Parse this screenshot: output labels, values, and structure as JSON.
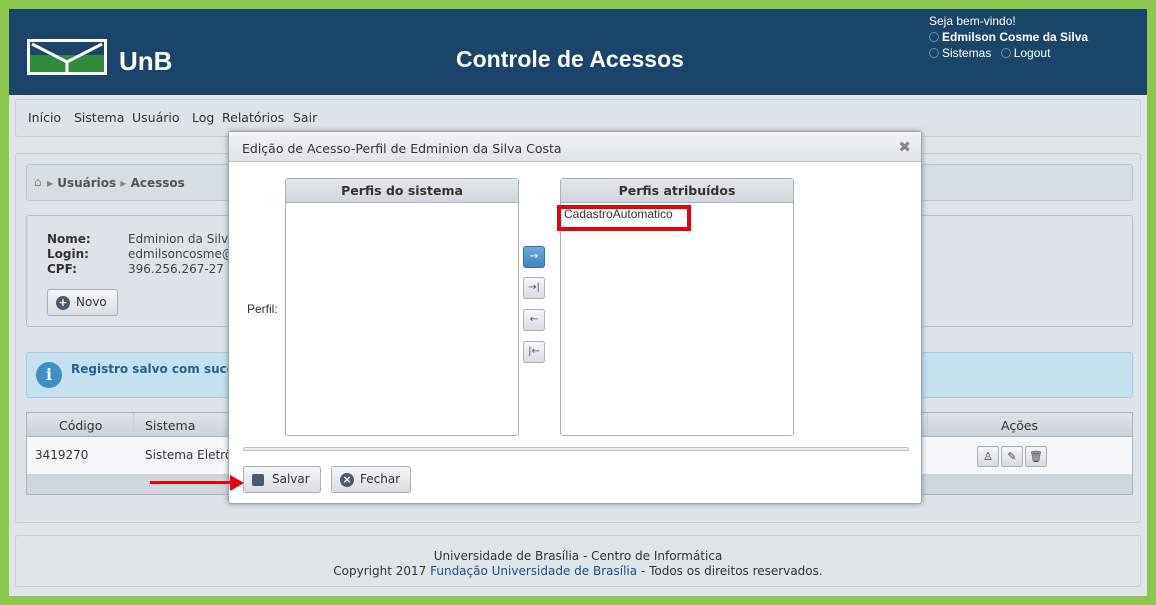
{
  "header": {
    "brand": "UnB",
    "title": "Controle de Acessos",
    "welcome": "Seja bem-vindo!",
    "user": "Edmilson Cosme da Silva",
    "sistemas": "Sistemas",
    "logout": "Logout"
  },
  "menu": {
    "items": [
      "Início",
      "Sistema",
      "Usuário",
      "Log",
      "Relatórios",
      "Sair"
    ]
  },
  "breadcrumb": {
    "usuarios": "Usuários",
    "acessos": "Acessos"
  },
  "user_info": {
    "nome_label": "Nome:",
    "nome_value": "Edminion da Silva",
    "login_label": "Login:",
    "login_value": "edmilsoncosme@",
    "cpf_label": "CPF:",
    "cpf_value": "396.256.267-27",
    "novo_label": "Novo"
  },
  "alert": {
    "message": "Registro salvo com sucess"
  },
  "table": {
    "headers": [
      "Código",
      "Sistema",
      "Ações"
    ],
    "rows": [
      {
        "codigo": "3419270",
        "sistema": "Sistema Eletrôn"
      }
    ]
  },
  "footer": {
    "line1": "Universidade de Brasília - Centro de Informática",
    "line2_prefix": "Copyright 2017",
    "line2_link": "Fundação Universidade de Brasília",
    "line2_suffix": "- Todos os direitos reservados."
  },
  "modal": {
    "title": "Edição de Acesso-Perfil de Edminion da Silva Costa",
    "perfil_label": "Perfil:",
    "left_list_title": "Perfis do sistema",
    "right_list_title": "Perfis atribuídos",
    "assigned": [
      "CadastroAutomatico"
    ],
    "buttons": {
      "salvar": "Salvar",
      "fechar": "Fechar"
    }
  },
  "colors": {
    "header_bg": "#19456b",
    "frame": "#8cc84b",
    "annotation": "#e8000b"
  }
}
